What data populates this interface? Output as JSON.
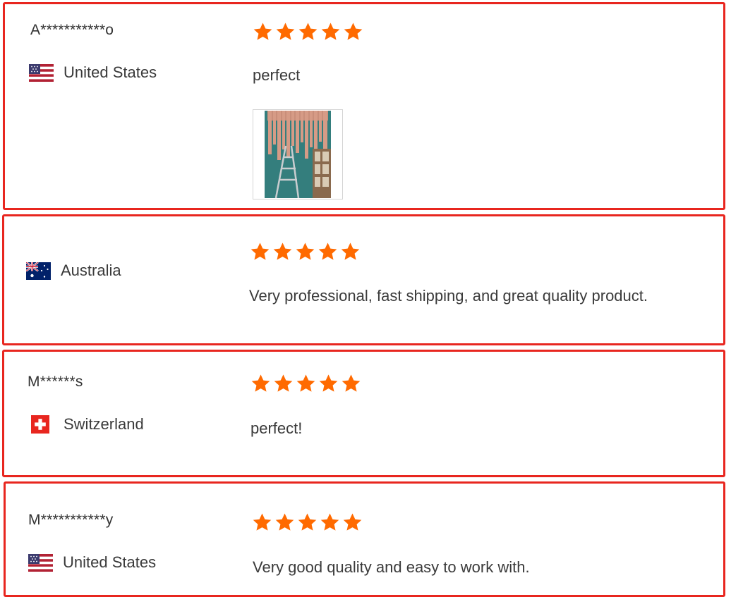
{
  "colors": {
    "border": "#e8261f",
    "star": "#ff6a00",
    "text": "#333333"
  },
  "reviews": [
    {
      "author": "A***********o",
      "country": "United States",
      "flag": "us-flag-icon",
      "rating": 5,
      "text": "perfect",
      "has_photo": true
    },
    {
      "author": "",
      "country": "Australia",
      "flag": "au-flag-icon",
      "rating": 5,
      "text": "Very professional, fast shipping, and great quality product."
    },
    {
      "author": "M******s",
      "country": "Switzerland",
      "flag": "ch-flag-icon",
      "rating": 5,
      "text": "perfect!"
    },
    {
      "author": "M***********y",
      "country": "United States",
      "flag": "us-flag-icon",
      "rating": 5,
      "text": "Very good quality and easy to work with."
    }
  ]
}
